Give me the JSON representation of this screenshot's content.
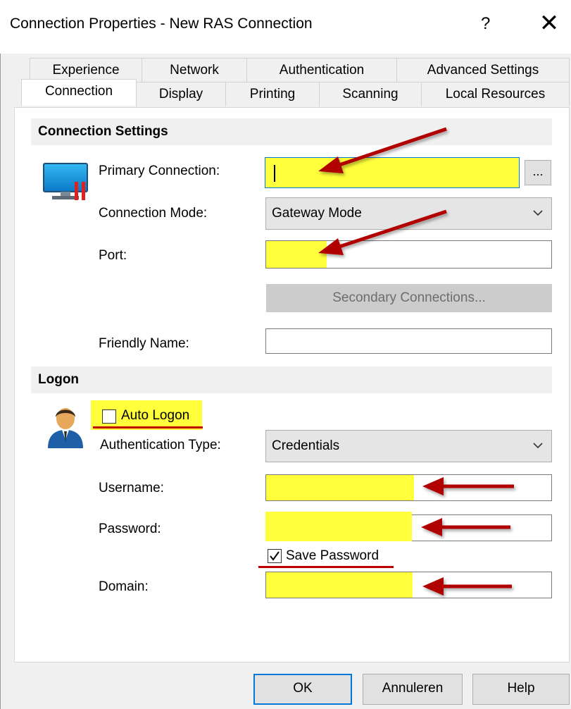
{
  "window": {
    "title": "Connection Properties - New RAS Connection",
    "help_symbol": "?",
    "close_symbol": "✕"
  },
  "tabs_top": [
    "Experience",
    "Network",
    "Authentication",
    "Advanced Settings"
  ],
  "tabs_bottom": [
    "Connection",
    "Display",
    "Printing",
    "Scanning",
    "Local Resources"
  ],
  "active_tab": "Connection",
  "connection_settings": {
    "header": "Connection Settings",
    "primary_connection_label": "Primary Connection:",
    "primary_connection_value": "",
    "browse_button": "...",
    "connection_mode_label": "Connection Mode:",
    "connection_mode_value": "Gateway Mode",
    "port_label": "Port:",
    "port_value": "",
    "secondary_connections_button": "Secondary Connections...",
    "friendly_name_label": "Friendly Name:",
    "friendly_name_value": ""
  },
  "logon": {
    "header": "Logon",
    "auto_logon_label": "Auto Logon",
    "auto_logon_checked": false,
    "authentication_type_label": "Authentication Type:",
    "authentication_type_value": "Credentials",
    "username_label": "Username:",
    "username_value": "",
    "password_label": "Password:",
    "password_value": "",
    "save_password_label": "Save Password",
    "save_password_checked": true,
    "domain_label": "Domain:",
    "domain_value": ""
  },
  "footer": {
    "ok_label": "OK",
    "cancel_label": "Annuleren",
    "help_label": "Help"
  },
  "colors": {
    "highlight": "#ffff3b",
    "annotation_arrow": "#b00000",
    "focus_border": "#0078d7"
  },
  "icons": [
    "monitor-icon",
    "user-icon",
    "chevron-down-icon",
    "arrow-annotation-icon"
  ]
}
